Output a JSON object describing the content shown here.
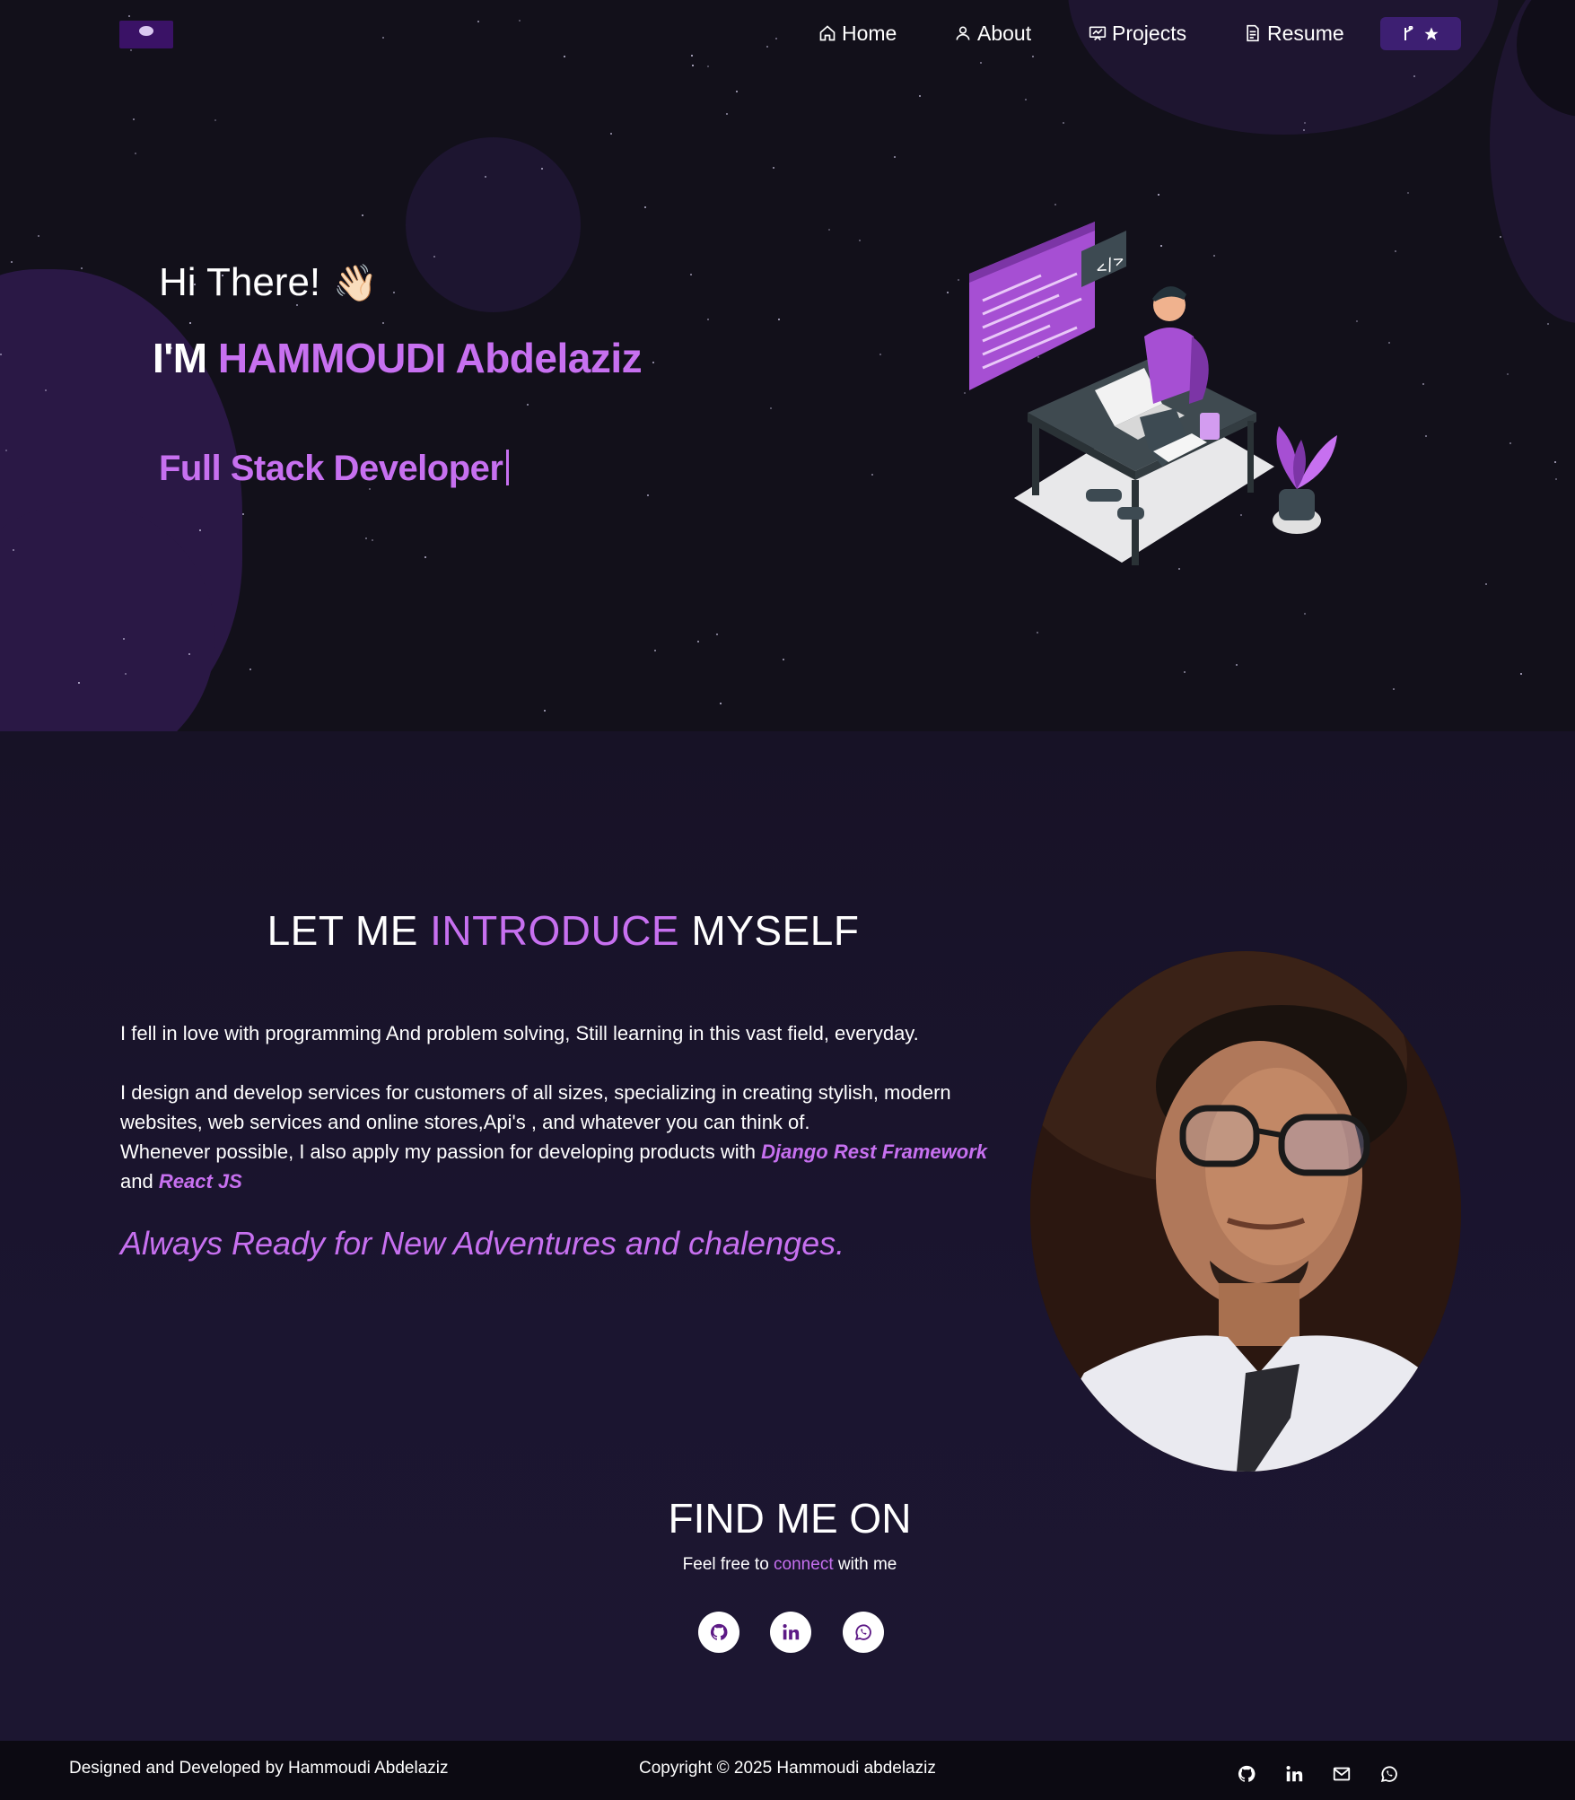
{
  "nav": {
    "items": [
      {
        "label": "Home",
        "icon": "home-icon"
      },
      {
        "label": "About",
        "icon": "user-icon"
      },
      {
        "label": "Projects",
        "icon": "projects-icon"
      },
      {
        "label": "Resume",
        "icon": "document-icon"
      }
    ],
    "github_button_icons": [
      "git-fork-icon",
      "star-icon"
    ]
  },
  "hero": {
    "greeting": "Hi There!",
    "wave": "👋🏻",
    "im_prefix": "I'M ",
    "name": "HAMMOUDI Abdelaziz",
    "role": "Full Stack Developer"
  },
  "intro": {
    "title_pre": "LET ME ",
    "title_accent": "INTRODUCE",
    "title_post": " MYSELF",
    "p1": "I fell in love with programming And problem solving, Still learning in this vast field, everyday.",
    "p2_a": "I design and develop services for customers of all sizes, specializing in creating stylish, modern websites, web services and online stores,Api's , and whatever you can think of.",
    "p2_b": "Whenever possible, I also apply my passion for developing products with ",
    "tech1": "Django Rest Framework",
    "and": "and",
    "tech2": "React JS",
    "tagline": "Always Ready for New Adventures and chalenges."
  },
  "find": {
    "title": "FIND ME ON",
    "sub_pre": "Feel free to ",
    "sub_accent": "connect",
    "sub_post": " with me",
    "socials": [
      "github-icon",
      "linkedin-icon",
      "whatsapp-icon"
    ]
  },
  "footer": {
    "left": "Designed and Developed by Hammoudi Abdelaziz",
    "copyright": "Copyright © 2025 Hammoudi abdelaziz",
    "icons": [
      "github-icon",
      "linkedin-icon",
      "mail-icon",
      "whatsapp-icon"
    ]
  },
  "colors": {
    "accent": "#c770f0",
    "background": "#14101f",
    "button": "#3d1f72"
  }
}
